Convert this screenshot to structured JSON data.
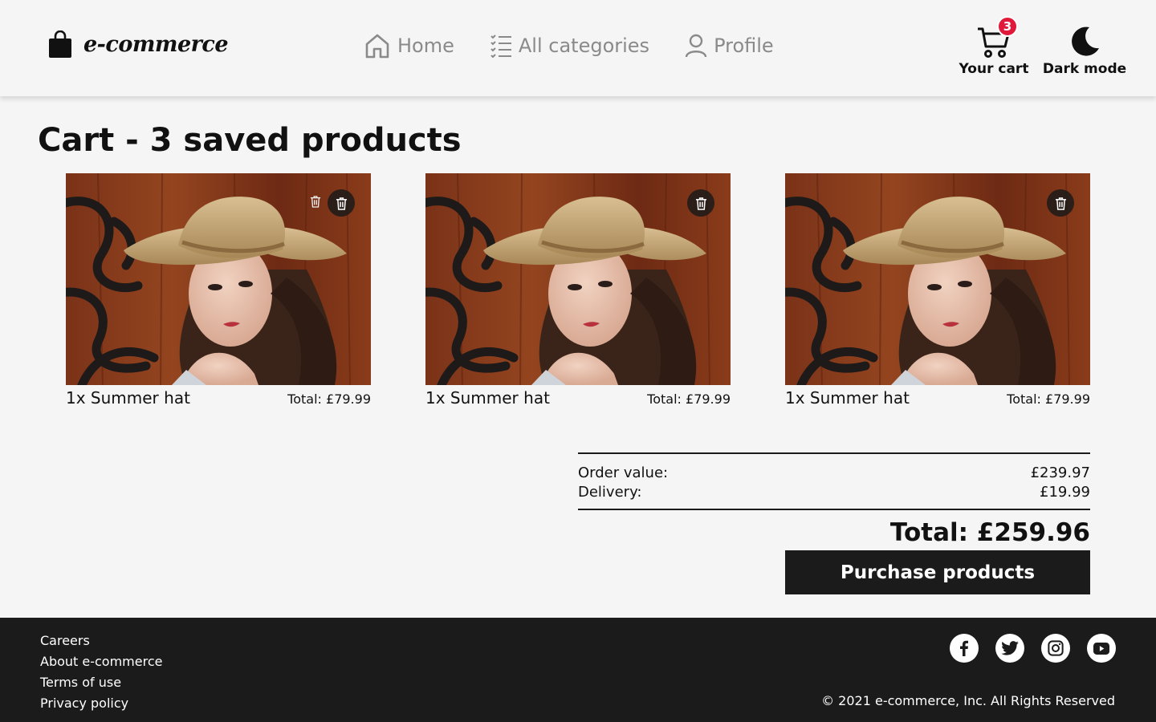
{
  "header": {
    "logo_text": "e-commerce",
    "logo_icon": "shopping-bag-icon",
    "nav": [
      {
        "label": "Home",
        "icon": "home-icon"
      },
      {
        "label": "All categories",
        "icon": "list-icon"
      },
      {
        "label": "Profile",
        "icon": "user-icon"
      }
    ],
    "cart": {
      "label": "Your cart",
      "count": "3",
      "icon": "cart-icon"
    },
    "dark_mode": {
      "label": "Dark mode",
      "icon": "moon-icon"
    }
  },
  "page": {
    "title_bold": "Cart",
    "title_rest": " - 3 saved products"
  },
  "products": [
    {
      "name": "1x Summer hat",
      "total": "Total: £79.99",
      "image": "woman in straw summer hat"
    },
    {
      "name": "1x Summer hat",
      "total": "Total: £79.99",
      "image": "woman in straw summer hat"
    },
    {
      "name": "1x Summer hat",
      "total": "Total: £79.99",
      "image": "woman in straw summer hat"
    }
  ],
  "summary": {
    "order_value_label": "Order value:",
    "order_value": "£239.97",
    "delivery_label": "Delivery:",
    "delivery": "£19.99",
    "total": "Total: £259.96",
    "purchase_label": "Purchase products"
  },
  "footer": {
    "links": [
      "Careers",
      "About e-commerce",
      "Terms of use",
      "Privacy policy"
    ],
    "socials": [
      "facebook-icon",
      "twitter-icon",
      "instagram-icon",
      "youtube-icon"
    ],
    "copyright": "© 2021 e-commerce, Inc. All Rights Reserved"
  },
  "colors": {
    "background": "#f5f5f5",
    "dark": "#1b1b1b",
    "badge": "#e0193a",
    "nav_text": "#8a8a8a"
  }
}
